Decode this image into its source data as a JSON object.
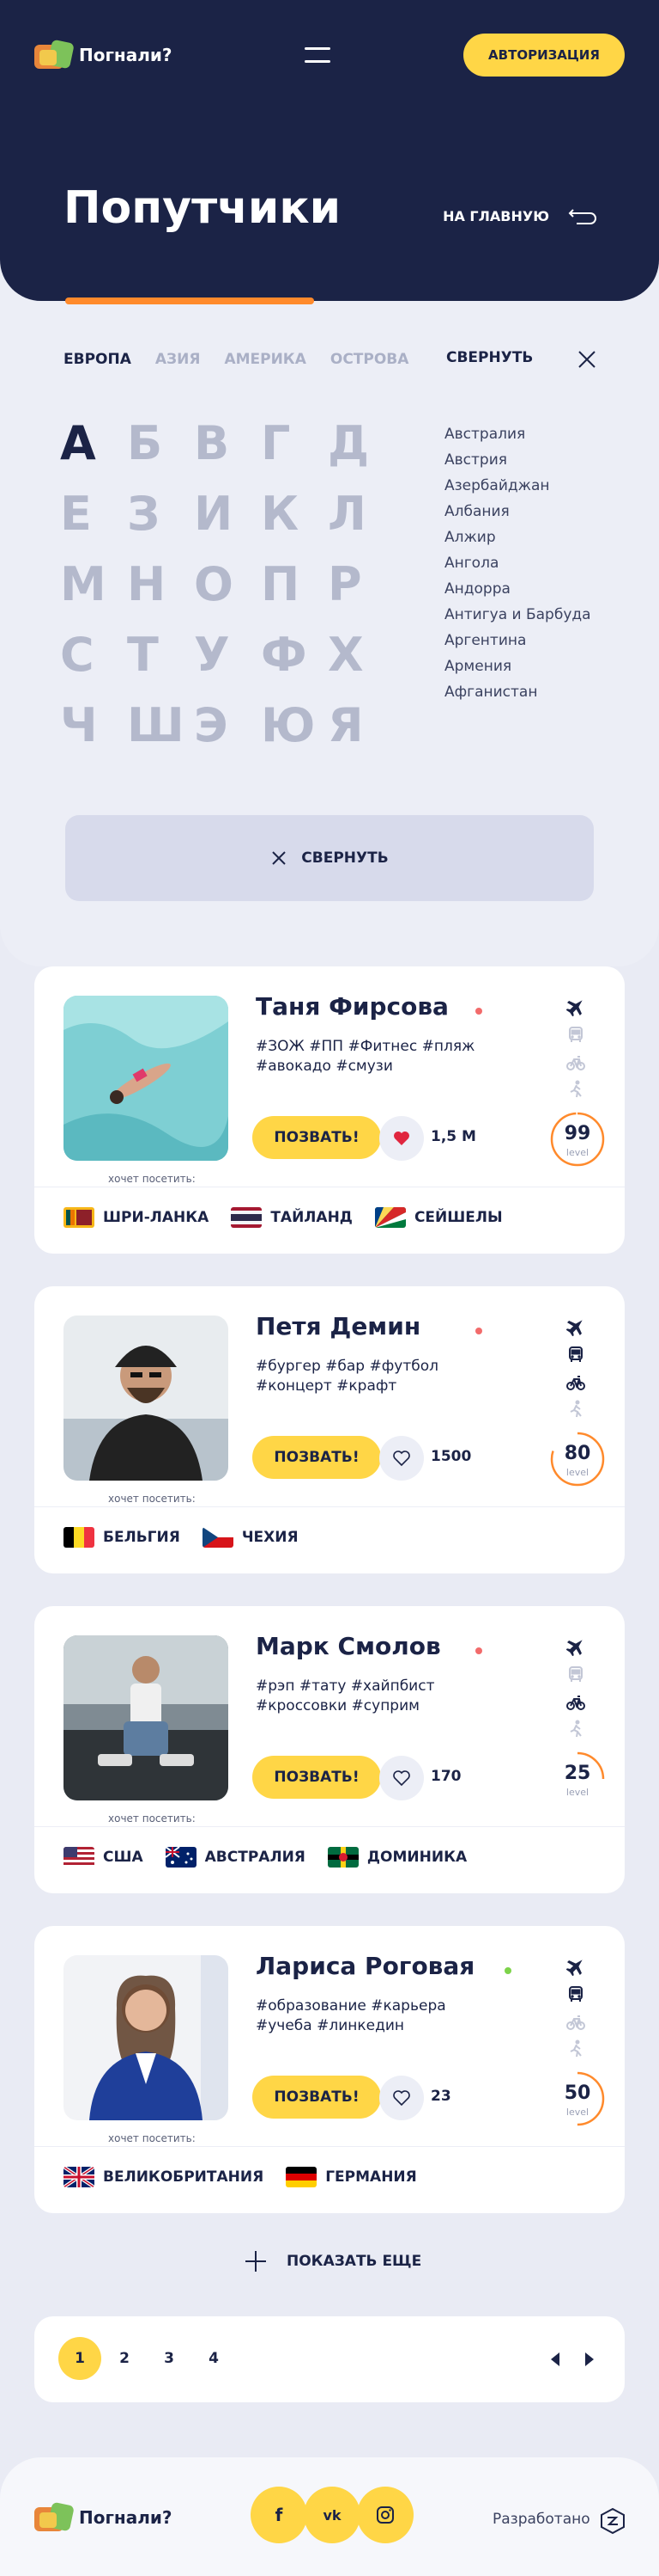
{
  "header": {
    "logo_text": "Погнали?",
    "auth_label": "АВТОРИЗАЦИЯ",
    "page_title": "Попутчики",
    "home_label": "НА ГЛАВНУЮ"
  },
  "filter": {
    "regions": [
      "ЕВРОПА",
      "АЗИЯ",
      "АМЕРИКА",
      "ОСТРОВА"
    ],
    "collapse_label": "СВЕРНУТЬ",
    "letters": [
      "А",
      "Б",
      "В",
      "Г",
      "Д",
      "Е",
      "З",
      "И",
      "К",
      "Л",
      "М",
      "Н",
      "О",
      "П",
      "Р",
      "С",
      "Т",
      "У",
      "Ф",
      "Х",
      "Ч",
      "Ш",
      "Э",
      "Ю",
      "Я"
    ],
    "countries": [
      "Австралия",
      "Австрия",
      "Азербайджан",
      "Албания",
      "Алжир",
      "Ангола",
      "Андорра",
      "Антигуа и Барбуда",
      "Аргентина",
      "Армения",
      "Афганистан"
    ],
    "collapse_big_label": "СВЕРНУТЬ"
  },
  "card_common": {
    "go_label": "ПОЗВАТЬ!",
    "wants_label": "хочет посетить:",
    "level_label": "level"
  },
  "cards": [
    {
      "name": "Таня Фирсова",
      "tags": "#ЗОЖ #ПП #Фитнес #пляж #авокадо #смузи",
      "likes": "1,5 М",
      "level": "99",
      "level_fraction": 0.99,
      "liked": true,
      "online_color": "#f26b6b",
      "transport_active": [
        true,
        false,
        false,
        false
      ],
      "destinations": [
        {
          "name": "ШРИ-ЛАНКА",
          "flag": "sri-lanka-flag"
        },
        {
          "name": "ТАЙЛАНД",
          "flag": "thailand-flag"
        },
        {
          "name": "СЕЙШЕЛЫ",
          "flag": "seychelles-flag"
        }
      ]
    },
    {
      "name": "Петя Демин",
      "tags": "#бургер #бар #футбол #концерт #крафт",
      "likes": "1500",
      "level": "80",
      "level_fraction": 0.8,
      "liked": false,
      "online_color": "#f26b6b",
      "transport_active": [
        true,
        true,
        true,
        false
      ],
      "destinations": [
        {
          "name": "БЕЛЬГИЯ",
          "flag": "belgium-flag"
        },
        {
          "name": "ЧЕХИЯ",
          "flag": "czech-flag"
        }
      ]
    },
    {
      "name": "Марк Смолов",
      "tags": "#рэп #тату #хайпбист #кроссовки #суприм",
      "likes": "170",
      "level": "25",
      "level_fraction": 0.25,
      "liked": false,
      "online_color": "#f26b6b",
      "transport_active": [
        true,
        false,
        true,
        false
      ],
      "destinations": [
        {
          "name": "США",
          "flag": "usa-flag"
        },
        {
          "name": "АВСТРАЛИЯ",
          "flag": "australia-flag"
        },
        {
          "name": "ДОМИНИКА",
          "flag": "dominica-flag"
        }
      ]
    },
    {
      "name": "Лариса Роговая",
      "tags": "#образование #карьера #учеба #линкедин",
      "likes": "23",
      "level": "50",
      "level_fraction": 0.5,
      "liked": false,
      "online_color": "#7dd34a",
      "transport_active": [
        true,
        true,
        false,
        false
      ],
      "destinations": [
        {
          "name": "ВЕЛИКОБРИТАНИЯ",
          "flag": "uk-flag"
        },
        {
          "name": "ГЕРМАНИЯ",
          "flag": "germany-flag"
        }
      ]
    }
  ],
  "show_more_label": "ПОКАЗАТЬ ЕЩЕ",
  "pagination": {
    "pages": [
      "1",
      "2",
      "3",
      "4"
    ],
    "current": "1"
  },
  "footer": {
    "logo_text": "Погнали?",
    "socials": [
      "facebook-icon",
      "vk-icon",
      "instagram-icon"
    ],
    "dev_label": "Разработано"
  },
  "colors": {
    "navy": "#1b2346",
    "yellow": "#ffd646",
    "orange": "#ff8a2c",
    "bg": "#e9ebf4"
  }
}
